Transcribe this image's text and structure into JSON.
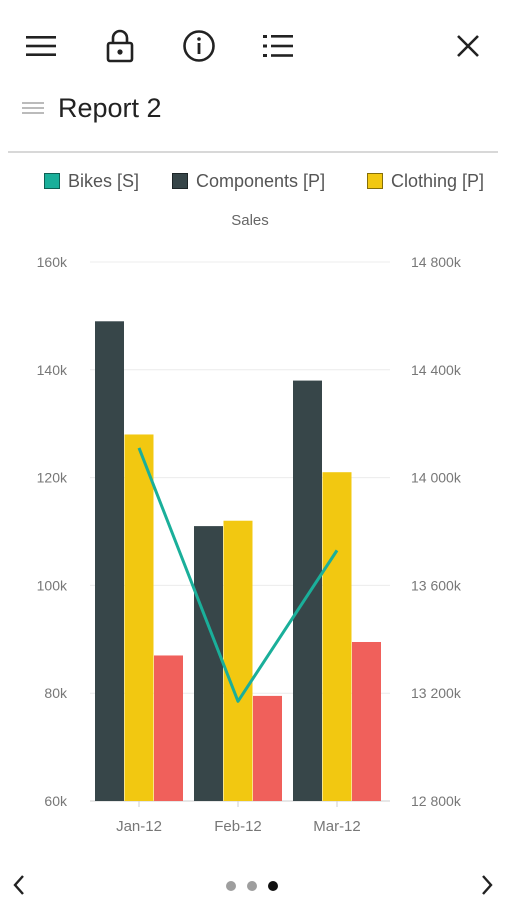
{
  "toolbar": {
    "icons": [
      "menu-icon",
      "lock-icon",
      "info-icon",
      "list-icon",
      "close-icon"
    ]
  },
  "report": {
    "title": "Report 2"
  },
  "colors": {
    "bikes": "#1aaf9a",
    "components": "#374649",
    "clothing": "#f2c811",
    "accessories": "#f0605b"
  },
  "pager": {
    "page_count": 3,
    "current_page": 3
  },
  "chart_data": {
    "type": "bar",
    "title": "Sales",
    "categories": [
      "Jan-12",
      "Feb-12",
      "Mar-12"
    ],
    "legend_entries": [
      "Bikes [S]",
      "Components [P]",
      "Clothing [P]"
    ],
    "legend_position": "top",
    "grid": true,
    "y_left_ticks": [
      "160k",
      "140k",
      "120k",
      "100k",
      "80k",
      "60k"
    ],
    "y_right_ticks": [
      "14 800k",
      "14 400k",
      "14 000k",
      "13 600k",
      "13 200k",
      "12 800k"
    ],
    "ylim_left": [
      60000,
      160000
    ],
    "ylim_right": [
      12800000,
      14800000
    ],
    "series": [
      {
        "name": "Components [P]",
        "kind": "bar",
        "axis": "left",
        "color": "#374649",
        "values": [
          149000,
          111000,
          138000
        ]
      },
      {
        "name": "Clothing [P]",
        "kind": "bar",
        "axis": "left",
        "color": "#f2c811",
        "values": [
          128000,
          112000,
          121000
        ]
      },
      {
        "kind": "bar",
        "axis": "left",
        "color": "#f0605b",
        "values": [
          87000,
          79500,
          89500
        ]
      },
      {
        "name": "Bikes [S]",
        "kind": "line",
        "axis": "right",
        "color": "#1aaf9a",
        "values": [
          14110000,
          13170000,
          13730000
        ]
      }
    ]
  }
}
